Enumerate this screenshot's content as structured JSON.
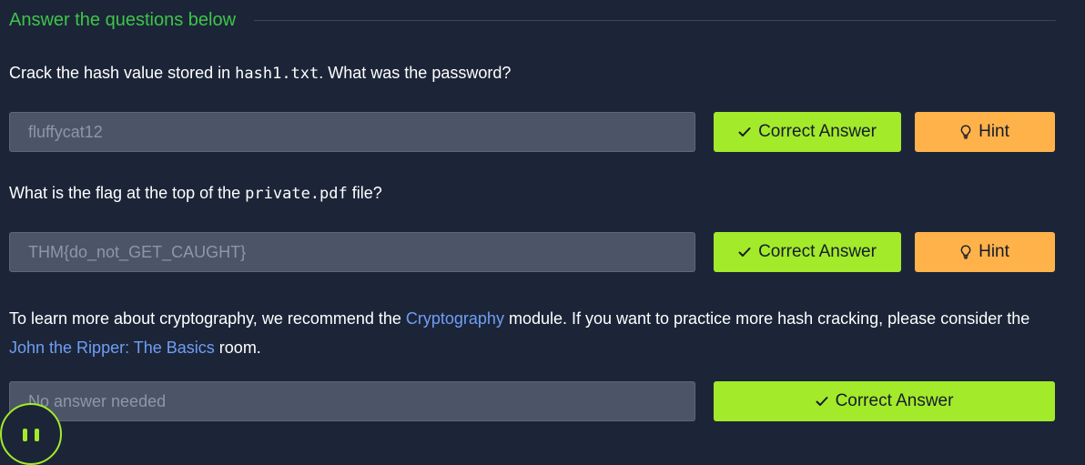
{
  "section": {
    "title": "Answer the questions below"
  },
  "questions": [
    {
      "text_before": "Crack the hash value stored in ",
      "code": "hash1.txt",
      "text_after": ". What was the password?",
      "answer": "fluffycat12",
      "correct_label": "Correct Answer",
      "hint_label": "Hint"
    },
    {
      "text_before": "What is the flag at the top of the ",
      "code": "private.pdf",
      "text_after": " file?",
      "answer": "THM{do_not_GET_CAUGHT}",
      "correct_label": "Correct Answer",
      "hint_label": "Hint"
    }
  ],
  "info": {
    "part1": "To learn more about cryptography, we recommend the ",
    "link1": "Cryptography",
    "part2": " module. If you want to practice more hash cracking, please consider the ",
    "link2": "John the Ripper: The Basics",
    "part3": " room.",
    "answer_placeholder": "No answer needed",
    "correct_label": "Correct Answer"
  },
  "colors": {
    "background": "#1c2538",
    "accent_green": "#a3ea2a",
    "title_green": "#3ec44a",
    "hint_orange": "#ffb24a",
    "link_blue": "#6f9ef5"
  },
  "icons": {
    "correct": "checkmark-icon",
    "hint": "lightbulb-icon",
    "fab": "pause-icon"
  }
}
